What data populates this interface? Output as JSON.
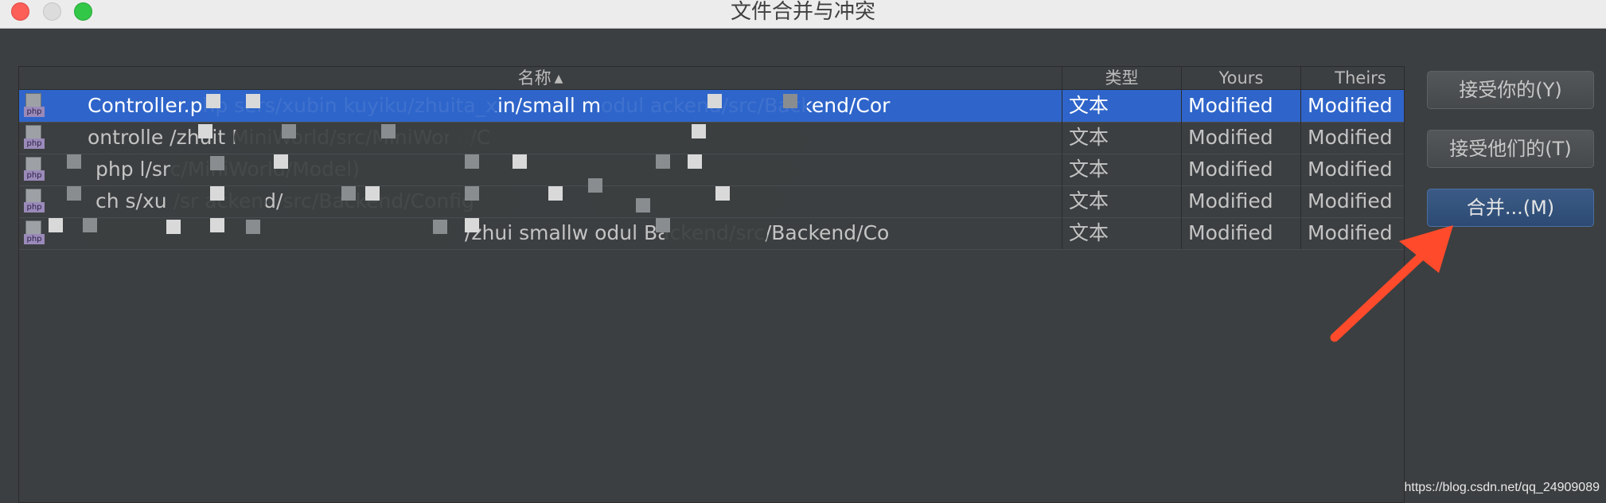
{
  "window": {
    "title": "文件合并与冲突"
  },
  "table": {
    "columns": {
      "name": "名称",
      "type": "类型",
      "yours": "Yours",
      "theirs": "Theirs"
    },
    "sort_indicator": "▲",
    "file_type_badge": "php",
    "rows": [
      {
        "name": "Controller.php  sers/xubin  kuyiku/zhuita_xin/small  modul  ackend/src/Backend/Cor",
        "type": "文本",
        "yours": "Modified",
        "theirs": "Modified",
        "selected": true
      },
      {
        "name": "ontrolle  /zhuit  MiniWorld/src/MiniWorld/C",
        "type": "文本",
        "yours": "Modified",
        "theirs": "Modified",
        "selected": false
      },
      {
        "name": "php  l/src/MiniWorld/Model)",
        "type": "文本",
        "yours": "Modified",
        "theirs": "Modified",
        "selected": false
      },
      {
        "name": "ch  s/xu  /sr  ackend/src/Backend/Config",
        "type": "文本",
        "yours": "Modified",
        "theirs": "Modified",
        "selected": false
      },
      {
        "name": "/zhui  smallw  odul  Backend/src/Backend/Co",
        "type": "文本",
        "yours": "Modified",
        "theirs": "Modified",
        "selected": false
      }
    ]
  },
  "actions": {
    "accept_yours": "接受你的(Y)",
    "accept_theirs": "接受他们的(T)",
    "merge": "合并...(M)"
  },
  "watermark": "https://blog.csdn.net/qq_24909089",
  "colors": {
    "selection": "#2f65ca",
    "annotation_arrow": "#ff4b2b",
    "background": "#3c3f41"
  }
}
